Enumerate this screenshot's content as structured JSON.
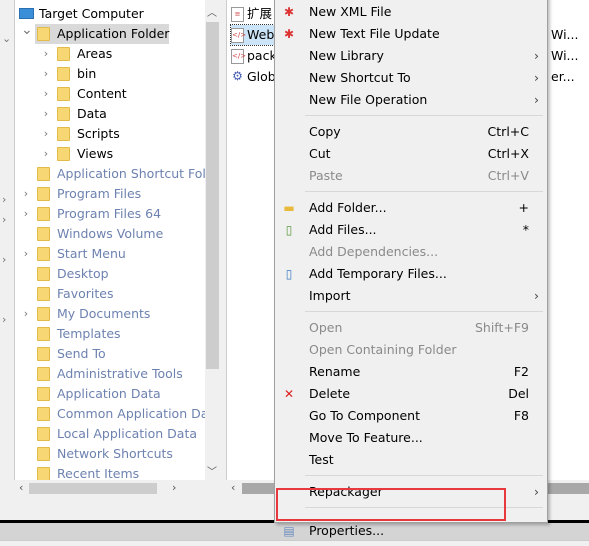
{
  "tree": {
    "root": {
      "label": "Target Computer",
      "icon": "computer-icon"
    },
    "items": [
      {
        "label": "Application Folder",
        "level": 1,
        "expanded": true,
        "selected": true,
        "dim": false
      },
      {
        "label": "Areas",
        "level": 2,
        "dim": false
      },
      {
        "label": "bin",
        "level": 2,
        "dim": false
      },
      {
        "label": "Content",
        "level": 2,
        "dim": false
      },
      {
        "label": "Data",
        "level": 2,
        "dim": false
      },
      {
        "label": "Scripts",
        "level": 2,
        "dim": false
      },
      {
        "label": "Views",
        "level": 2,
        "dim": false
      },
      {
        "label": "Application Shortcut Fold",
        "level": 1,
        "dim": true,
        "chevron": false
      },
      {
        "label": "Program Files",
        "level": 1,
        "dim": true,
        "chevron": true
      },
      {
        "label": "Program Files 64",
        "level": 1,
        "dim": true,
        "chevron": true
      },
      {
        "label": "Windows Volume",
        "level": 1,
        "dim": true,
        "chevron": false
      },
      {
        "label": "Start Menu",
        "level": 1,
        "dim": true,
        "chevron": true
      },
      {
        "label": "Desktop",
        "level": 1,
        "dim": true,
        "chevron": false
      },
      {
        "label": "Favorites",
        "level": 1,
        "dim": true,
        "chevron": false
      },
      {
        "label": "My Documents",
        "level": 1,
        "dim": true,
        "chevron": true
      },
      {
        "label": "Templates",
        "level": 1,
        "dim": true,
        "chevron": false
      },
      {
        "label": "Send To",
        "level": 1,
        "dim": true,
        "chevron": false
      },
      {
        "label": "Administrative Tools",
        "level": 1,
        "dim": true,
        "chevron": false
      },
      {
        "label": "Application Data",
        "level": 1,
        "dim": true,
        "chevron": false
      },
      {
        "label": "Common Application Dat",
        "level": 1,
        "dim": true,
        "chevron": false
      },
      {
        "label": "Local Application Data",
        "level": 1,
        "dim": true,
        "chevron": false
      },
      {
        "label": "Network Shortcuts",
        "level": 1,
        "dim": true,
        "chevron": false
      },
      {
        "label": "Recent Items",
        "level": 1,
        "dim": true,
        "chevron": false
      }
    ]
  },
  "files": [
    {
      "name": "扩展",
      "icon": "text-file-icon",
      "extra": ""
    },
    {
      "name": "Web",
      "icon": "xml-file-icon",
      "extra": "Wi...",
      "selected": true
    },
    {
      "name": "pack",
      "icon": "xml-file-icon",
      "extra": "Wi..."
    },
    {
      "name": "Glob",
      "icon": "assembly-icon",
      "extra": "er..."
    }
  ],
  "menu": {
    "items": [
      {
        "label": "New XML File",
        "icon": "new-xml-file-icon"
      },
      {
        "label": "New Text File Update",
        "icon": "new-text-file-icon"
      },
      {
        "label": "New Library",
        "submenu": true
      },
      {
        "label": "New Shortcut To",
        "submenu": true
      },
      {
        "label": "New File Operation",
        "submenu": true
      },
      {
        "sep": true
      },
      {
        "label": "Copy",
        "shortcut": "Ctrl+C"
      },
      {
        "label": "Cut",
        "shortcut": "Ctrl+X"
      },
      {
        "label": "Paste",
        "shortcut": "Ctrl+V",
        "disabled": true
      },
      {
        "sep": true
      },
      {
        "label": "Add Folder...",
        "shortcut": "+",
        "icon": "add-folder-icon"
      },
      {
        "label": "Add Files...",
        "shortcut": "*",
        "icon": "add-files-icon"
      },
      {
        "label": "Add Dependencies...",
        "disabled": true
      },
      {
        "label": "Add Temporary Files...",
        "icon": "add-temp-files-icon"
      },
      {
        "label": "Import",
        "submenu": true
      },
      {
        "sep": true
      },
      {
        "label": "Open",
        "shortcut": "Shift+F9",
        "disabled": true
      },
      {
        "label": "Open Containing Folder",
        "disabled": true
      },
      {
        "label": "Rename",
        "shortcut": "F2"
      },
      {
        "label": "Delete",
        "shortcut": "Del",
        "icon": "delete-icon"
      },
      {
        "label": "Go To Component",
        "shortcut": "F8"
      },
      {
        "label": "Move To Feature..."
      },
      {
        "label": "Test"
      },
      {
        "sep": true
      },
      {
        "label": "Repackager",
        "submenu": true
      },
      {
        "sep": true
      },
      {
        "label": "Properties...",
        "icon": "properties-icon",
        "highlighted": true
      }
    ]
  },
  "colors": {
    "highlight_box": "#e8383d",
    "dim_text": "#6d82b0",
    "folder": "#f7d774"
  }
}
